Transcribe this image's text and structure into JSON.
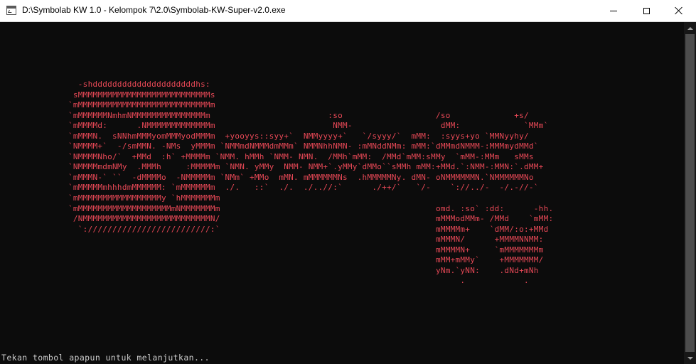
{
  "window": {
    "title": "D:\\Symbolab KW 1.0 - Kelompok 7\\2.0\\Symbolab-KW-Super-v2.0.exe",
    "icon": "console-app-icon",
    "controls": {
      "minimize": "minimize-icon",
      "maximize": "maximize-icon",
      "close": "close-icon"
    }
  },
  "console": {
    "background": "#0c0c0c",
    "art_color": "#e74856",
    "text_color": "#cccccc",
    "art": "  -shdddddddddddddddddddddhs:\n sMMMMMMMMMMMMMMMMMMMMMMMMMMMs\n`mMMMMMMMMMMMMMMMMMMMMMMMMMMMm\n`mMMMMMMNmhmNMMMMMMMMMMMMMMMm                        :so                   /so             +s/\n`mMMMMd:      .NMMMMMMMMMMMMMm                        NMM-                  dMM:             `MMm`\n`mMMMN.  sNNhmMMMyomMMMyodMMMm  +yooyys::syy+`  NMMyyyy+`   `/syyy/`  mMM:  :syys+yo `MMNyyhy/\n`NMMMM+`  -/smMMN. -NMs  yMMMm `NMMmdNMMMdmMMm` NMMNhhNMN- :mMNddNMm: mMM:`dMMmdNMMM-:MMMmydMMd`\n`NMMMMNho/`  +MMd  :h` +MMMMm `NMM. hMMh `NMM- NMN.  /MMh`mMM:  /MMd`mMM:sMMy  `mMM-:MMm   sMMs\n`NMMMMmdmNMy  .MMMh     :MMMMMm `NMN. yMMy  NMM- NMM+`.yMMy`dMMo``sMMh mMM:+MMd.`:NMM-:MMN:`.dMM+\n`mMMMN-` ``  -dMMMMo  -NMMMMMm `NMm` +MMo  mMN. mMMMMMMNs  .hMMMMMNy. dMN- oNMMMMMMN.`NMMMMMMNo\n`mMMMMMmhhhdmMMMMMM: `mMMMMMMm  ./.   ::`  ./.  ./..//:`      ./++/`   `/-    `://../-  -/.-//-`\n`mMMMMMMMMMMMMMMMMMy `hMMMMMMMm\n`mMMMMMMMMMMMMMMMMMMMmNMMMMMMMm                                            omd. :so` :dd:      -hh.\n /NMMMMMMMMMMMMMMMMMMMMMMMMMMN/                                            mMMModMMm- /MMd    `mMM:\n  `://///////////////////////:`                                            mMMMMm+    `dMM/:o:+MMd\n                                                                           mMMMN/      +MMMMNNMM:\n                                                                           mMMMMN+     `mMMMMMMMm\n                                                                           mMM+mMMy`    +MMMMMMM/\n                                                                           yNm.`yNN:    .dNd+mNh\n                                                                                .            .",
    "prompt": "Tekan tombol apapun untuk melanjutkan..."
  }
}
